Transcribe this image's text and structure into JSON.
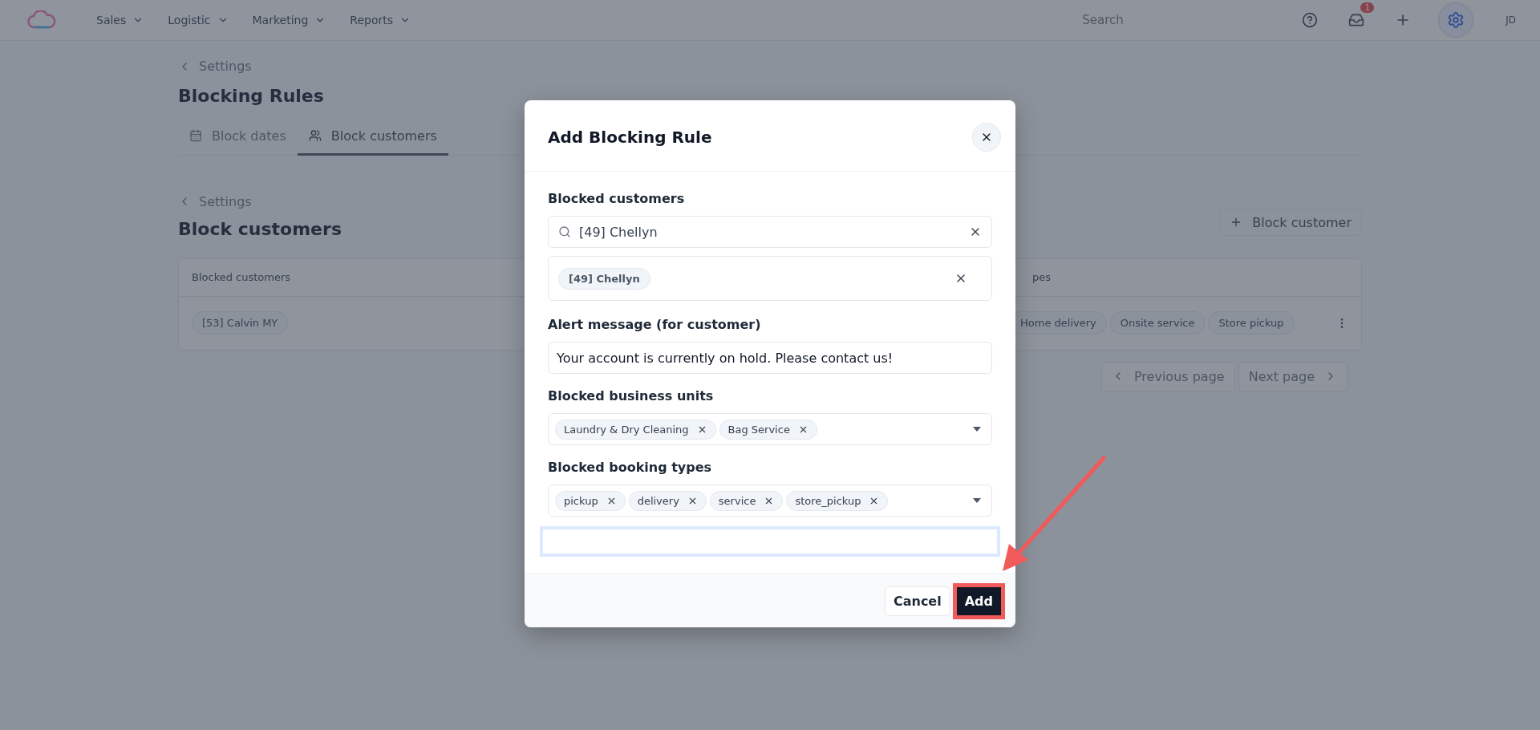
{
  "topbar": {
    "nav": [
      {
        "label": "Sales"
      },
      {
        "label": "Logistic"
      },
      {
        "label": "Marketing"
      },
      {
        "label": "Reports"
      }
    ],
    "search": {
      "placeholder": "Search"
    },
    "inbox_badge": "1",
    "avatar": "JD"
  },
  "breadcrumb": "Settings",
  "title": "Blocking Rules",
  "tabs": [
    {
      "label": "Block dates",
      "selected": false
    },
    {
      "label": "Block customers",
      "selected": true
    }
  ],
  "section": {
    "breadcrumb": "Settings",
    "title": "Block customers",
    "action": "Block customer"
  },
  "table": {
    "columns": [
      "Blocked customers",
      "pes"
    ],
    "rows": [
      {
        "customer": "[53] Calvin MY",
        "booking_types": [
          "Home delivery",
          "Onsite service",
          "Store pickup"
        ]
      }
    ]
  },
  "pagination": {
    "previous": "Previous page",
    "next": "Next page"
  },
  "dialog": {
    "title": "Add Blocking Rule",
    "customers": {
      "label": "Blocked customers",
      "search_value": "[49] Chellyn",
      "selected": [
        "[49] Chellyn"
      ]
    },
    "alert": {
      "label": "Alert message (for customer)",
      "value": "Your account is currently on hold. Please contact us!"
    },
    "business_units": {
      "label": "Blocked business units",
      "tags": [
        "Laundry & Dry Cleaning",
        "Bag Service"
      ]
    },
    "booking_types": {
      "label": "Blocked booking types",
      "tags": [
        "pickup",
        "delivery",
        "service",
        "store_pickup"
      ]
    },
    "extra_field": {
      "focused": true
    },
    "buttons": [
      {
        "label": "Cancel",
        "kind": "secondary",
        "highlighted": false
      },
      {
        "label": "Add",
        "kind": "primary",
        "highlighted": true
      }
    ]
  },
  "annotation": {
    "arrow": true
  }
}
